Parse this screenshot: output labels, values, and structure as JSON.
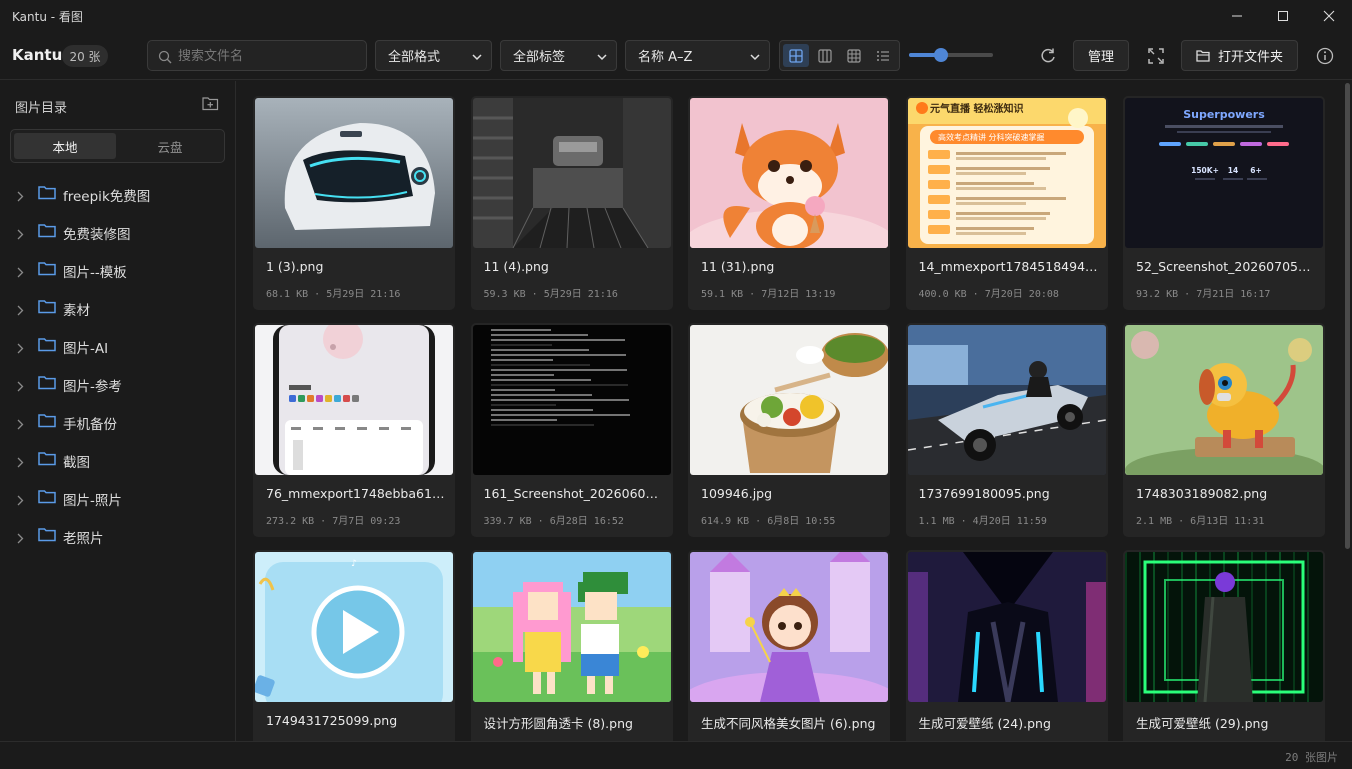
{
  "window": {
    "title": "Kantu - 看图",
    "minimize_icon": "minimize-icon",
    "maximize_icon": "maximize-icon",
    "close_icon": "close-icon"
  },
  "toolbar": {
    "brand": "Kantu",
    "count_badge": "20 张",
    "search_placeholder": "搜索文件名",
    "format_filter": "全部格式",
    "tag_filter": "全部标签",
    "sort": "名称 A–Z",
    "view_modes": [
      "grid-large-icon",
      "columns-icon",
      "grid-small-icon",
      "list-icon"
    ],
    "active_view": 0,
    "thumb_size_fraction": 0.35,
    "manage_label": "管理",
    "open_folder_label": "打开文件夹"
  },
  "sidebar": {
    "heading": "图片目录",
    "tabs": [
      {
        "label": "本地",
        "active": true
      },
      {
        "label": "云盘",
        "active": false
      }
    ],
    "folders": [
      {
        "label": "freepik免费图"
      },
      {
        "label": "免费装修图"
      },
      {
        "label": "图片--模板"
      },
      {
        "label": "素材"
      },
      {
        "label": "图片-AI"
      },
      {
        "label": "图片-参考"
      },
      {
        "label": "手机备份"
      },
      {
        "label": "截图"
      },
      {
        "label": "图片-照片"
      },
      {
        "label": "老照片"
      }
    ]
  },
  "images": [
    {
      "name": "1 (3).png",
      "meta": "68.1 KB · 5月29日 21:16",
      "subject": "helmet"
    },
    {
      "name": "11 (4).png",
      "meta": "59.3 KB · 5月29日 21:16",
      "subject": "machine"
    },
    {
      "name": "11 (31).png",
      "meta": "59.1 KB · 7月12日 13:19",
      "subject": "fox"
    },
    {
      "name": "14_mmexport1784518494222...",
      "meta": "400.0 KB · 7月20日 20:08",
      "subject": "poster",
      "poster_title": "元气直播 轻松涨知识",
      "poster_sub": "高效考点精讲 分科突破速掌握"
    },
    {
      "name": "52_Screenshot_20260705_22...",
      "meta": "93.2 KB · 7月21日 16:17",
      "subject": "superpowers",
      "hero": "Superpowers",
      "stats": [
        "150K+",
        "14",
        "6+"
      ]
    },
    {
      "name": "76_mmexport1748ebba617b...",
      "meta": "273.2 KB · 7月7日 09:23",
      "subject": "phone"
    },
    {
      "name": "161_Screenshot_20260607_2...",
      "meta": "339.7 KB · 6月28日 16:52",
      "subject": "terminal"
    },
    {
      "name": "109946.jpg",
      "meta": "614.9 KB · 6月8日 10:55",
      "subject": "food"
    },
    {
      "name": "1737699180095.png",
      "meta": "1.1 MB · 4月20日 11:59",
      "subject": "car"
    },
    {
      "name": "1748303189082.png",
      "meta": "2.1 MB · 6月13日 11:31",
      "subject": "dog"
    },
    {
      "name": "1749431725099.png",
      "meta": "",
      "subject": "play"
    },
    {
      "name": "设计方形圆角透卡 (8).png",
      "meta": "",
      "subject": "pixel"
    },
    {
      "name": "生成不同风格美女图片 (6).png",
      "meta": "",
      "subject": "princess"
    },
    {
      "name": "生成可爱壁纸 (24).png",
      "meta": "",
      "subject": "neon-blue"
    },
    {
      "name": "生成可爱壁纸 (29).png",
      "meta": "",
      "subject": "neon-green"
    }
  ],
  "status": {
    "text": "20 张图片"
  }
}
